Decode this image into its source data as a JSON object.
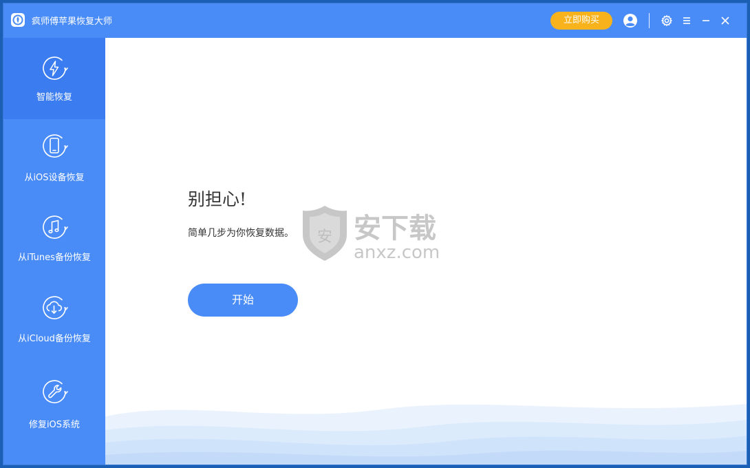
{
  "titlebar": {
    "app_title": "疯师傅苹果恢复大师",
    "buy_label": "立即购买"
  },
  "sidebar": {
    "items": [
      {
        "label": "智能恢复",
        "icon": "lightning-refresh-icon",
        "active": true
      },
      {
        "label": "从iOS设备恢复",
        "icon": "phone-refresh-icon",
        "active": false
      },
      {
        "label": "从iTunes备份恢复",
        "icon": "music-refresh-icon",
        "active": false
      },
      {
        "label": "从iCloud备份恢复",
        "icon": "cloud-download-refresh-icon",
        "active": false
      },
      {
        "label": "修复iOS系统",
        "icon": "wrench-refresh-icon",
        "active": false
      }
    ]
  },
  "main": {
    "heading": "别担心!",
    "subtext": "简单几步为你恢复数据。",
    "start_label": "开始"
  },
  "watermark": {
    "shield_char": "安",
    "brand": "安下载",
    "domain": "anxz.com"
  },
  "colors": {
    "primary": "#4a8cf7",
    "active_nav": "#3b7df0",
    "buy": "#f7b21c"
  }
}
